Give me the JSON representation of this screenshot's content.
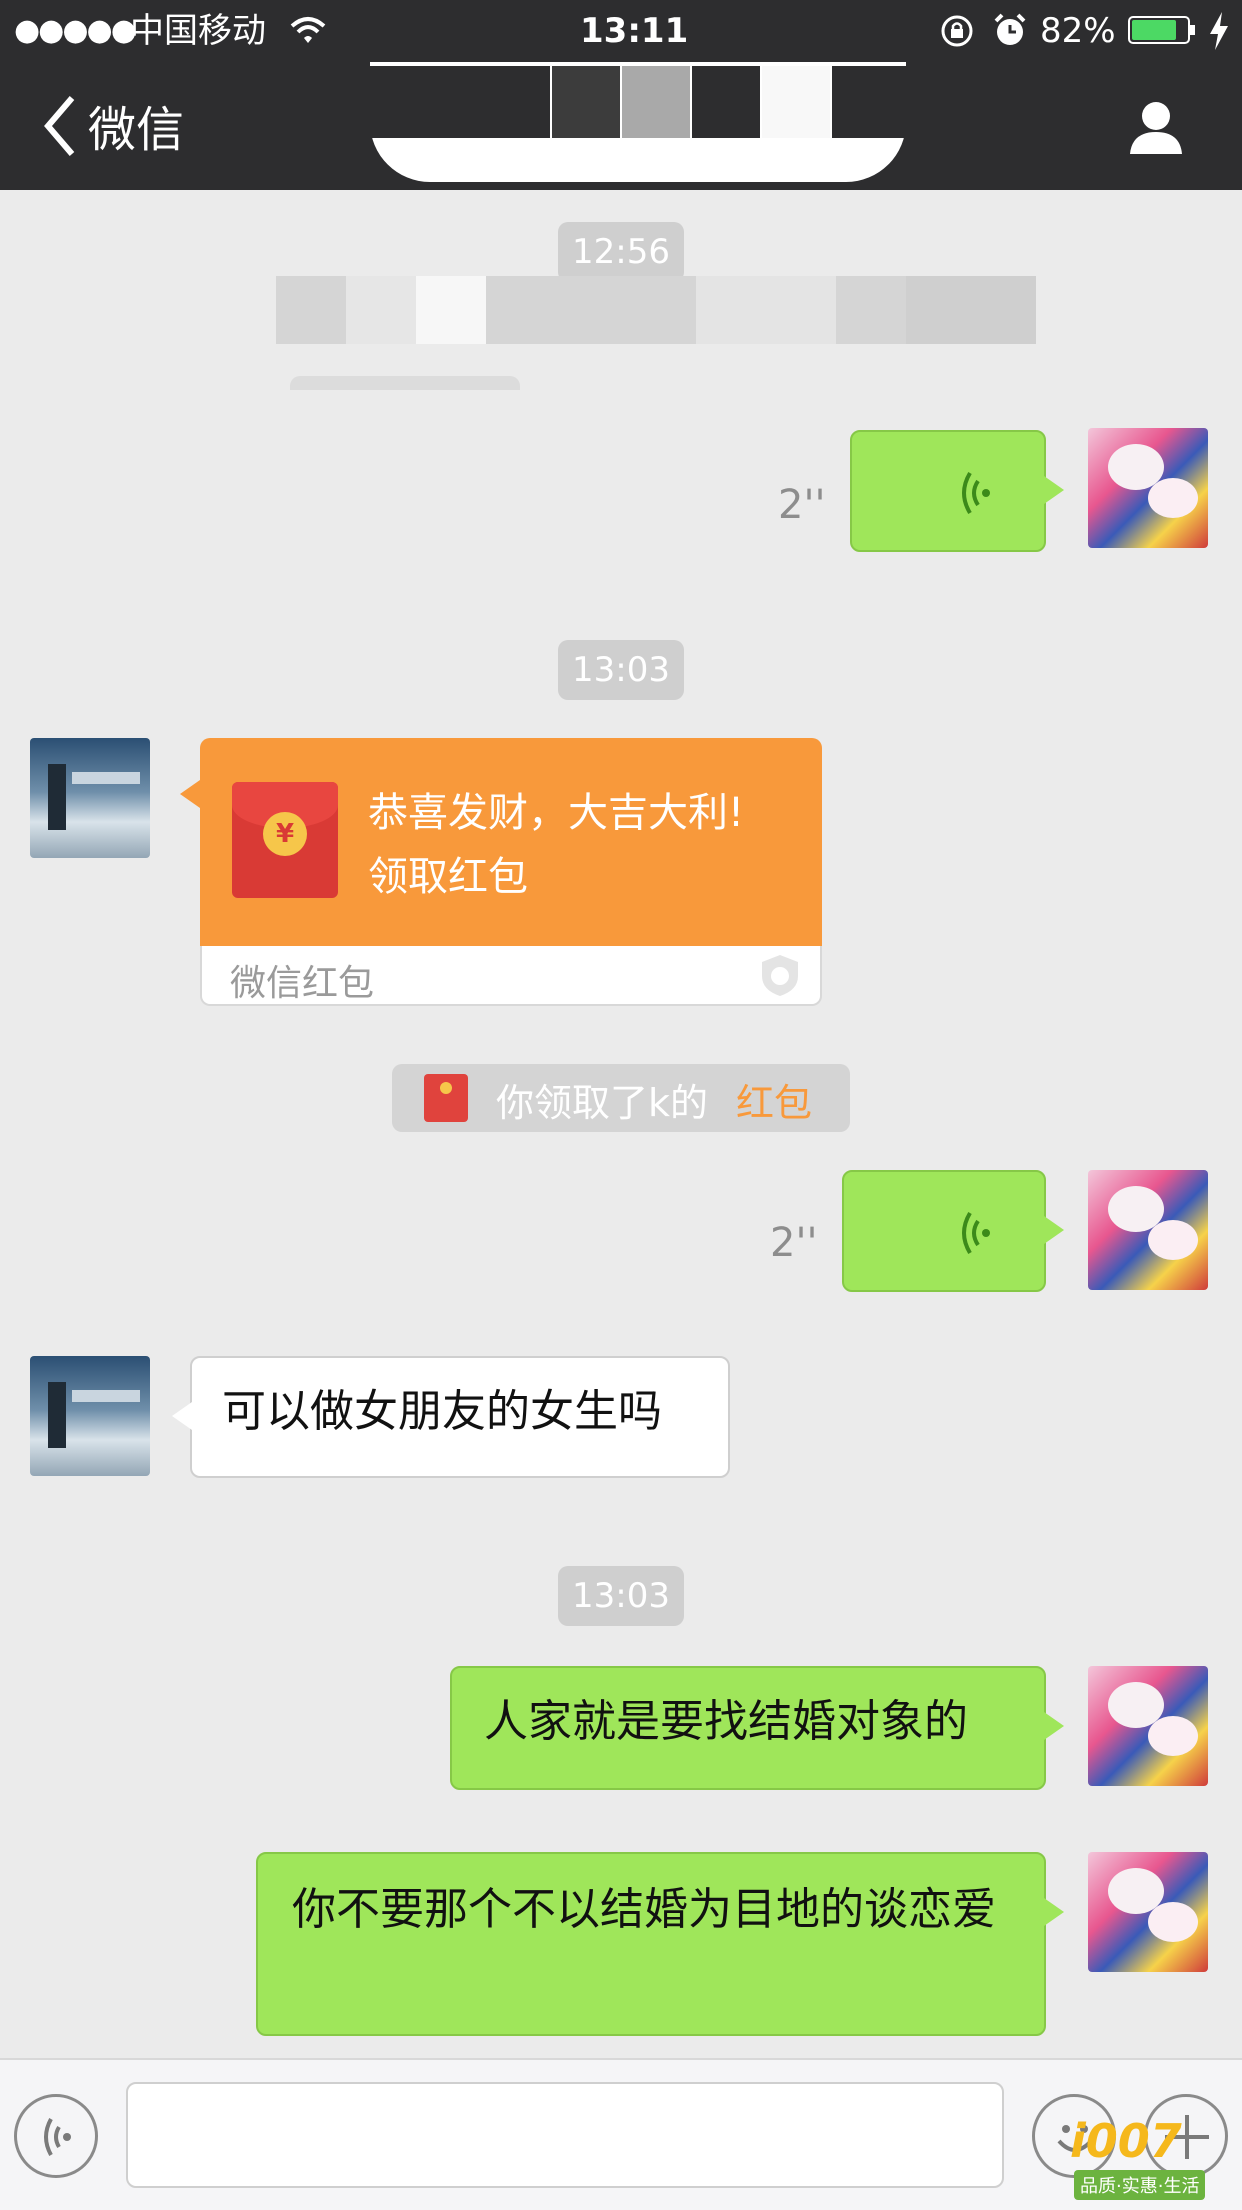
{
  "status_bar": {
    "signal": "●●●●●",
    "carrier": "中国移动",
    "time": "13:11",
    "battery_percent": "82%",
    "battery_level": 0.82
  },
  "nav": {
    "back_label": "微信"
  },
  "messages": {
    "ts1": "12:56",
    "voice1_duration": "2''",
    "ts2": "13:03",
    "redpacket_greeting": "恭喜发财，大吉大利!",
    "redpacket_action": "领取红包",
    "redpacket_footer": "微信红包",
    "notice_prefix": "你领取了k的",
    "notice_link": "红包",
    "voice2_duration": "2''",
    "incoming_text": "可以做女朋友的女生吗",
    "ts3": "13:03",
    "outgoing_text1": "人家就是要找结婚对象的",
    "outgoing_text2": "你不要那个不以结婚为目地的谈恋爱"
  },
  "watermark": {
    "brand": "i007",
    "tagline": "品质·实惠·生活"
  },
  "colors": {
    "bar_bg": "#2d2d2f",
    "chat_bg": "#ebebeb",
    "bubble_green": "#9fe65a",
    "redpacket_orange": "#f8993b",
    "link_orange": "#f8993b",
    "battery_green": "#4cd964"
  },
  "icons": {
    "wifi": "wifi-icon",
    "lock": "rotation-lock-icon",
    "alarm": "alarm-icon",
    "battery": "battery-icon",
    "charging": "charging-bolt-icon",
    "back": "chevron-left-icon",
    "profile": "person-icon",
    "voice_toggle": "voice-icon",
    "emoji": "emoji-icon",
    "more": "plus-icon"
  }
}
